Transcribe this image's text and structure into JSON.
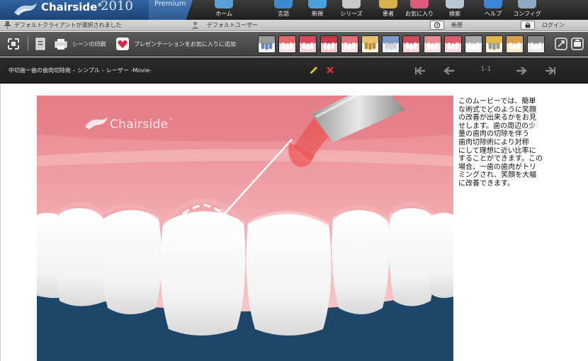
{
  "app": {
    "name": "Chairside",
    "year": "2010",
    "edition": "Premium",
    "trademark": "®"
  },
  "menu": [
    {
      "label": "ホーム",
      "icon": "home-icon",
      "color": "#5a9fd8"
    },
    {
      "label": "言語",
      "icon": "language-icon",
      "color": "#3b8bd0"
    },
    {
      "label": "新規",
      "icon": "new-icon",
      "color": "#4aa0de"
    },
    {
      "label": "シリーズ",
      "icon": "series-icon",
      "color": "#c9c9c9"
    },
    {
      "label": "患者",
      "icon": "patient-icon",
      "color": "#d8b04a"
    },
    {
      "label": "お気に入り",
      "icon": "favorites-icon",
      "color": "#e05a78"
    },
    {
      "label": "検索",
      "icon": "search-icon",
      "color": "#b8c7d8"
    },
    {
      "label": "ヘルプ",
      "icon": "help-icon",
      "color": "#3d85d6"
    },
    {
      "label": "コンフィグ",
      "icon": "config-icon",
      "color": "#8fa8c4"
    }
  ],
  "status": {
    "client": "デフォルトクライアントが選択されました",
    "user": "デフォルトユーザー",
    "history_label": "新歴",
    "login_label": "ログイン"
  },
  "toolbar": {
    "print_label": "シーンの印刷",
    "favorite_label": "プレゼンテーションをお気に入りに追加",
    "thumbnails": [
      {
        "name": "thumb-tools"
      },
      {
        "name": "thumb-gum-red"
      },
      {
        "name": "thumb-teeth-open"
      },
      {
        "name": "thumb-teeth-smile"
      },
      {
        "name": "thumb-lips"
      },
      {
        "name": "thumb-roots"
      },
      {
        "name": "thumb-instrument"
      },
      {
        "name": "thumb-bite"
      },
      {
        "name": "thumb-teeth-front"
      },
      {
        "name": "thumb-jaw"
      },
      {
        "name": "thumb-tooth-single"
      },
      {
        "name": "thumb-drill"
      },
      {
        "name": "thumb-brush"
      },
      {
        "name": "thumb-implant"
      }
    ]
  },
  "movie": {
    "title": "中切歯一歯の歯肉切除術 – シンプル – レーザー -Movie-",
    "page": "1-1",
    "watermark": "Chairside",
    "watermark_tm": "™",
    "description": "このムービーでは、簡単\nな術式でどのように笑顔\nの改善が出来るかをお見\nせします。歯の周辺の少\n量の歯肉の切除を伴う\n歯肉切除術により対称\nにして理想に近い比率に\nすることができます。この\n場合、一歯の歯肉がトリ\nミングされ、笑顔を大幅\nに改善できます。"
  },
  "colors": {
    "brand_blue": "#1b4477",
    "gum_pink": "#e8838d",
    "background_navy": "#1e4668",
    "delete_red": "#e53030",
    "edit_yellow": "#e8c020"
  }
}
